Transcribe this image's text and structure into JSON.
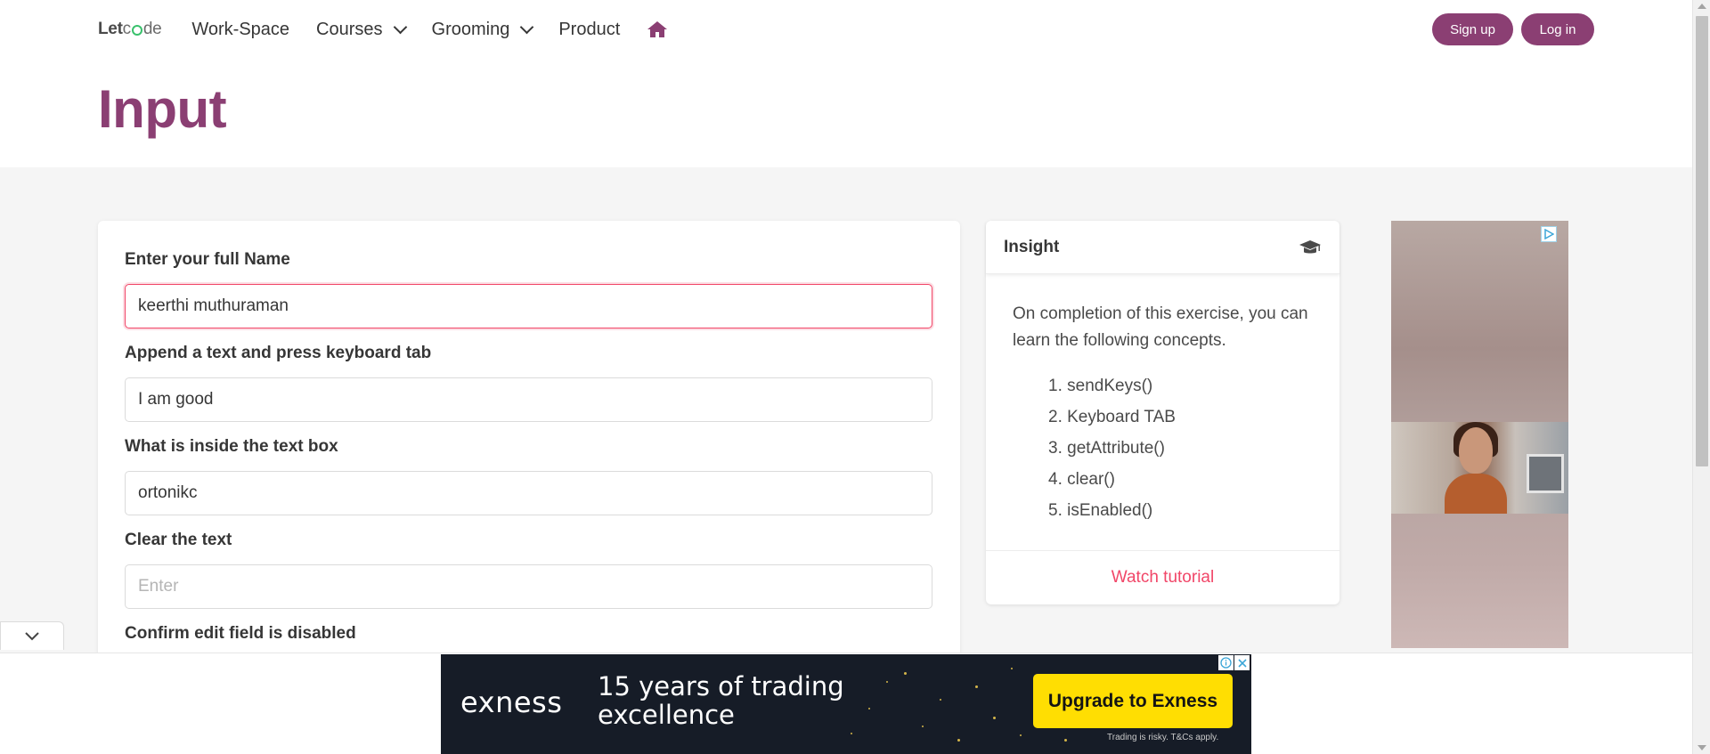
{
  "nav": {
    "logo_prefix": "Let",
    "logo_suffix": "de",
    "items": [
      {
        "label": "Work-Space"
      },
      {
        "label": "Courses"
      },
      {
        "label": "Grooming"
      },
      {
        "label": "Product"
      }
    ],
    "home_icon": "home-icon",
    "signup_label": "Sign up",
    "login_label": "Log in"
  },
  "page": {
    "title": "Input"
  },
  "form": {
    "fields": [
      {
        "label": "Enter your full Name",
        "value": "keerthi muthuraman",
        "state": "focused"
      },
      {
        "label": "Append a text and press keyboard tab",
        "value": "I am good"
      },
      {
        "label": "What is inside the text box",
        "value": "ortonikc"
      },
      {
        "label": "Clear the text",
        "placeholder": "Enter"
      },
      {
        "label": "Confirm edit field is disabled"
      }
    ]
  },
  "insight": {
    "title": "Insight",
    "icon": "graduation-cap-icon",
    "intro": "On completion of this exercise, you can learn the following concepts.",
    "concepts": [
      "1. sendKeys()",
      "2. Keyboard TAB",
      "3. getAttribute()",
      "4. clear()",
      "5. isEnabled()"
    ],
    "tutorial_label": "Watch tutorial"
  },
  "bottom_ad": {
    "brand": "exness",
    "tagline": "15 years of trading excellence",
    "cta": "Upgrade to Exness",
    "disclaimer": "Trading is risky. T&Cs apply.",
    "accent": "#ffde02"
  },
  "colors": {
    "brand": "#8b3f73",
    "danger": "#f14668"
  }
}
